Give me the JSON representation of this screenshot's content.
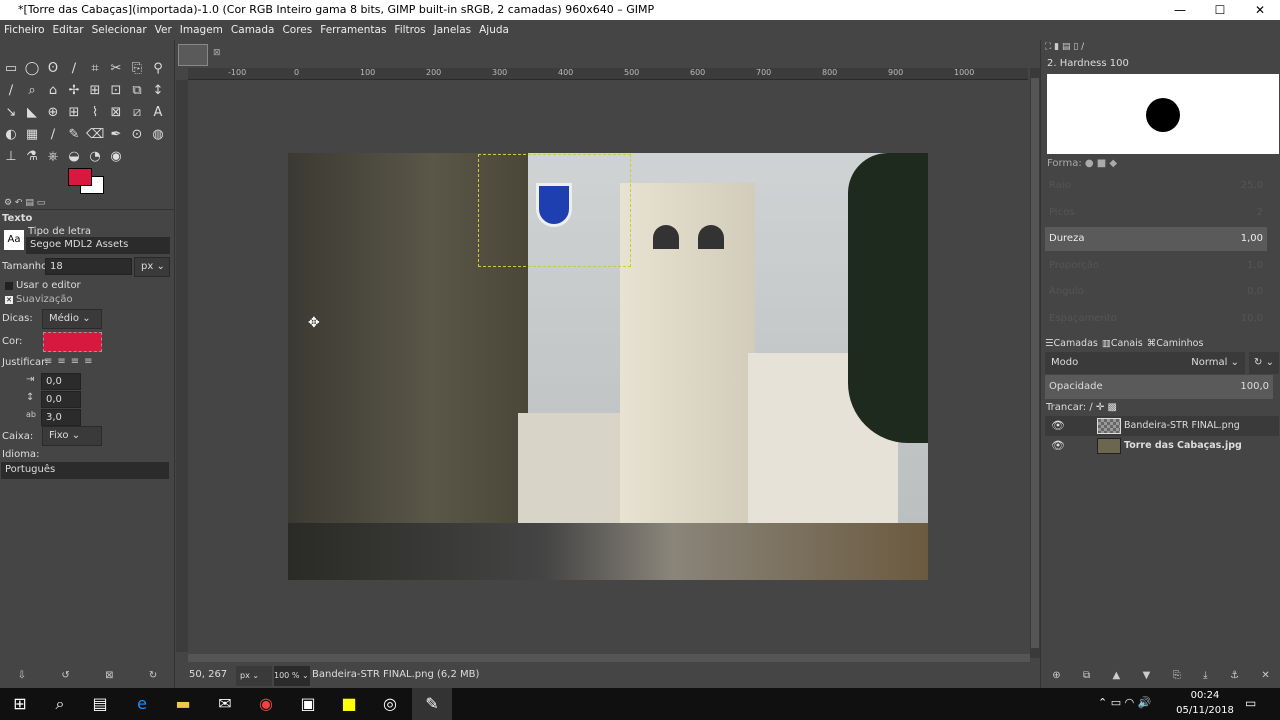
{
  "window": {
    "title": "*[Torre das Cabaças](importada)-1.0 (Cor RGB Inteiro gama 8 bits, GIMP built-in sRGB, 2 camadas) 960x640 – GIMP",
    "minimize": "—",
    "maximize": "☐",
    "close": "✕"
  },
  "menu": [
    "Ficheiro",
    "Editar",
    "Selecionar",
    "Ver",
    "Imagem",
    "Camada",
    "Cores",
    "Ferramentas",
    "Filtros",
    "Janelas",
    "Ajuda"
  ],
  "toolopts": {
    "title": "Texto",
    "font_label": "Tipo de letra",
    "font_value": "Segoe MDL2 Assets",
    "font_icon": "Aa",
    "size_label": "Tamanho:",
    "size_value": "18",
    "size_unit": "px",
    "use_editor": "Usar o editor",
    "antialias": "Suavização",
    "hints_label": "Dicas:",
    "hints_value": "Médio",
    "color_label": "Cor:",
    "color_value": "#d9183f",
    "justify_label": "Justificar:",
    "indent": "0,0",
    "line_spacing": "0,0",
    "letter_spacing": "3,0",
    "box_label": "Caixa:",
    "box_value": "Fixo",
    "language_label": "Idioma:",
    "language_value": "Português"
  },
  "colors": {
    "fg": "#d9183f",
    "bg": "#ffffff"
  },
  "ruler": [
    "-100",
    "0",
    "100",
    "200",
    "300",
    "400",
    "500",
    "600",
    "700",
    "800",
    "900",
    "1000"
  ],
  "status": {
    "coords": "50, 267",
    "unit": "px",
    "zoom": "100 %",
    "info": "Bandeira-STR FINAL.png (6,2 MB)"
  },
  "brushes": {
    "name": "2. Hardness 100",
    "shape_label": "Forma:",
    "params": [
      {
        "label": "Raio",
        "value": "25,0",
        "active": false
      },
      {
        "label": "Picos",
        "value": "2",
        "active": false
      },
      {
        "label": "Dureza",
        "value": "1,00",
        "active": true
      },
      {
        "label": "Proporção",
        "value": "1,0",
        "active": false
      },
      {
        "label": "Ângulo",
        "value": "0,0",
        "active": false
      },
      {
        "label": "Espaçamento",
        "value": "10,0",
        "active": false
      }
    ]
  },
  "layers": {
    "tabs": [
      "Camadas",
      "Canais",
      "Caminhos"
    ],
    "mode_label": "Modo",
    "mode_value": "Normal",
    "opacity_label": "Opacidade",
    "opacity_value": "100,0",
    "lock_label": "Trancar:",
    "items": [
      {
        "name": "Bandeira-STR FINAL.png",
        "visible": true
      },
      {
        "name": "Torre das Cabaças.jpg",
        "visible": true
      }
    ]
  },
  "taskbar": {
    "time": "00:24",
    "date": "05/11/2018"
  }
}
